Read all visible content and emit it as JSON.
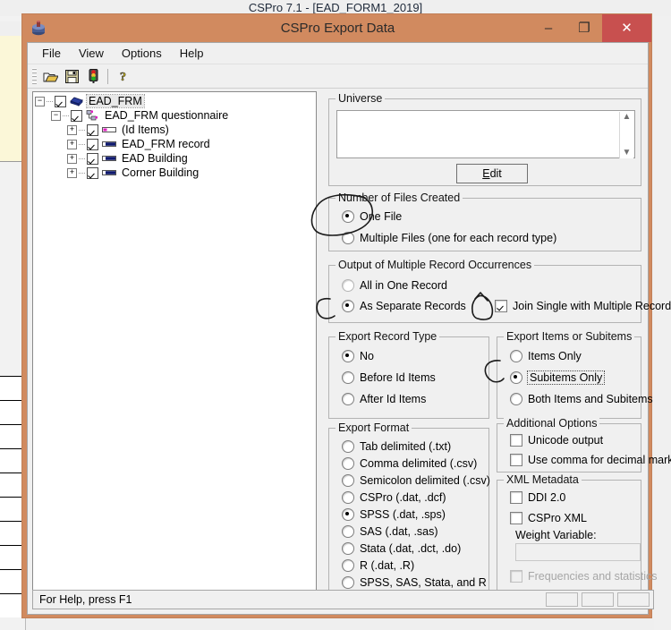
{
  "background_window": {
    "title": "CSPro 7.1 - [EAD_FORM1_2019]"
  },
  "window": {
    "title": "CSPro Export Data",
    "icon": "cspro-app-icon",
    "buttons": {
      "minimize": "–",
      "maximize": "❐",
      "close": "✕"
    },
    "accent_color": "#D18A5F",
    "close_color": "#C8504F"
  },
  "menu": {
    "items": [
      "File",
      "View",
      "Options",
      "Help"
    ]
  },
  "toolbar": {
    "buttons": [
      {
        "name": "open-icon",
        "glyph": "📂"
      },
      {
        "name": "save-icon",
        "glyph": "💾"
      },
      {
        "name": "traffic-light-icon",
        "glyph": "🚦"
      },
      {
        "name": "help-icon",
        "glyph": "?"
      }
    ]
  },
  "tree": {
    "nodes": [
      {
        "label": "EAD_FRM",
        "indent": 1,
        "expander": "−",
        "checked": true,
        "icon": "dictionary-icon",
        "selected": true
      },
      {
        "label": "EAD_FRM questionnaire",
        "indent": 2,
        "expander": "−",
        "checked": true,
        "icon": "level-icon",
        "selected": false
      },
      {
        "label": "(Id Items)",
        "indent": 3,
        "expander": "+",
        "checked": true,
        "icon": "id-record-icon",
        "selected": false
      },
      {
        "label": "EAD_FRM record",
        "indent": 3,
        "expander": "+",
        "checked": true,
        "icon": "record-icon",
        "selected": false
      },
      {
        "label": "EAD Building",
        "indent": 3,
        "expander": "+",
        "checked": true,
        "icon": "record-icon",
        "selected": false
      },
      {
        "label": "Corner Building",
        "indent": 3,
        "expander": "+",
        "checked": true,
        "icon": "record-icon",
        "selected": false
      }
    ]
  },
  "universe": {
    "legend": "Universe",
    "value": "",
    "edit_button": {
      "prefix": "",
      "accel": "E",
      "suffix": "dit"
    }
  },
  "number_of_files": {
    "legend": "Number of Files Created",
    "options": [
      {
        "label": "One File",
        "selected": true,
        "annotated": true
      },
      {
        "label": "Multiple Files (one for each record type)",
        "selected": false,
        "annotated": false
      }
    ]
  },
  "output_occurrences": {
    "legend": "Output of Multiple Record Occurrences",
    "options": [
      {
        "label": "All in One Record",
        "selected": false,
        "disabled": true,
        "annotated": false
      },
      {
        "label": "As Separate Records",
        "selected": true,
        "disabled": false,
        "annotated": true
      }
    ],
    "join_checkbox": {
      "label": "Join Single with Multiple Records",
      "checked": true,
      "annotated": true
    }
  },
  "export_record_type": {
    "legend": "Export Record Type",
    "options": [
      {
        "label": "No",
        "selected": true
      },
      {
        "label": "Before Id Items",
        "selected": false
      },
      {
        "label": "After Id Items",
        "selected": false
      }
    ]
  },
  "export_items": {
    "legend": "Export Items or Subitems",
    "options": [
      {
        "label": "Items Only",
        "selected": false,
        "focused": false,
        "annotated": false
      },
      {
        "label": "Subitems Only",
        "selected": true,
        "focused": true,
        "annotated": true
      },
      {
        "label": "Both Items and Subitems",
        "selected": false,
        "focused": false,
        "annotated": false
      }
    ]
  },
  "export_format": {
    "legend": "Export Format",
    "options": [
      {
        "label": "Tab delimited (.txt)",
        "selected": false
      },
      {
        "label": "Comma delimited (.csv)",
        "selected": false
      },
      {
        "label": "Semicolon delimited (.csv)",
        "selected": false
      },
      {
        "label": "CSPro (.dat, .dcf)",
        "selected": false
      },
      {
        "label": "SPSS (.dat, .sps)",
        "selected": true
      },
      {
        "label": "SAS (.dat, .sas)",
        "selected": false
      },
      {
        "label": "Stata (.dat, .dct, .do)",
        "selected": false
      },
      {
        "label": "R (.dat, .R)",
        "selected": false
      },
      {
        "label": "SPSS, SAS, Stata, and R",
        "selected": false
      }
    ]
  },
  "additional_options": {
    "legend": "Additional Options",
    "options": [
      {
        "label": "Unicode output",
        "checked": false
      },
      {
        "label": "Use comma for decimal mark",
        "checked": false
      }
    ]
  },
  "xml_metadata": {
    "legend": "XML Metadata",
    "options": [
      {
        "label": "DDI 2.0",
        "checked": false,
        "disabled": false
      },
      {
        "label": "CSPro XML",
        "checked": false,
        "disabled": false
      }
    ],
    "weight_label": "Weight Variable:",
    "weight_value": "",
    "frequencies": {
      "label": "Frequencies and statistics",
      "checked": false,
      "disabled": true
    }
  },
  "statusbar": {
    "text": "For Help, press F1",
    "panes": 3
  }
}
